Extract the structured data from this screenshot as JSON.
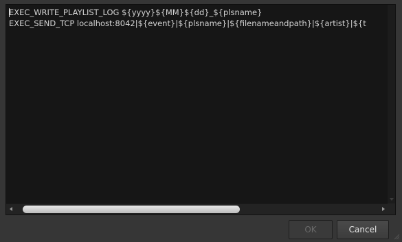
{
  "editor": {
    "lines": [
      "EXEC_WRITE_PLAYLIST_LOG ${yyyy}${MM}${dd}_${plsname}",
      "EXEC_SEND_TCP localhost:8042|${event}|${plsname}|${filenameandpath}|${artist}|${t"
    ]
  },
  "buttons": {
    "ok_label": "OK",
    "cancel_label": "Cancel"
  },
  "colors": {
    "background": "#363636",
    "editor_background": "#161616",
    "text": "#d4d4d4",
    "disabled_text": "#6a6a6a"
  },
  "icons": {
    "scroll_left": "arrow-left-icon",
    "scroll_right": "arrow-right-icon",
    "scroll_down": "arrow-down-icon",
    "resize": "resize-grip-icon"
  }
}
